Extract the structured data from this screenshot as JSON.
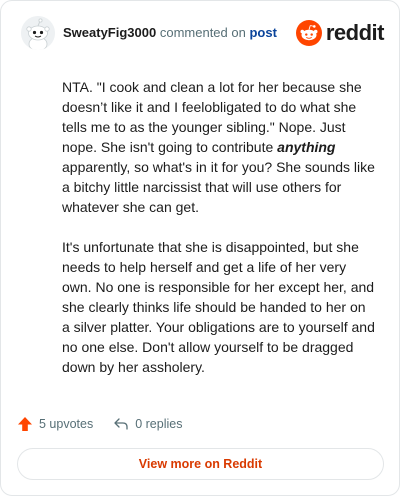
{
  "header": {
    "username": "SweatyFig3000",
    "commented_on": "commented on",
    "post_link": "post",
    "brand": "reddit"
  },
  "comment": {
    "p1_before": "NTA. \"I cook and clean a lot for her because she doesn’t like it and I feelobligated to do what she tells me to as the younger sibling.\" Nope. Just nope. She isn't going to contribute ",
    "p1_emph": "anything",
    "p1_after": " apparently, so what's in it for you? She sounds like a bitchy little narcissist that will use others for whatever she can get.",
    "p2": "It's unfortunate that she is disappointed, but she needs to help herself and get a life of her very own. No one is responsible for her except her, and she clearly thinks life should be handed to her on a silver platter. Your obligations are to yourself and no one else. Don't allow yourself to be dragged down by her assholery."
  },
  "actions": {
    "upvotes": "5 upvotes",
    "replies": "0 replies"
  },
  "footer": {
    "view_more": "View more on Reddit"
  },
  "colors": {
    "accent": "#ff4500",
    "link": "#0a449b",
    "muted": "#576f76"
  },
  "icons": [
    "avatar-snoo-icon",
    "reddit-logo-icon",
    "upvote-arrow-icon",
    "reply-arrow-icon"
  ]
}
